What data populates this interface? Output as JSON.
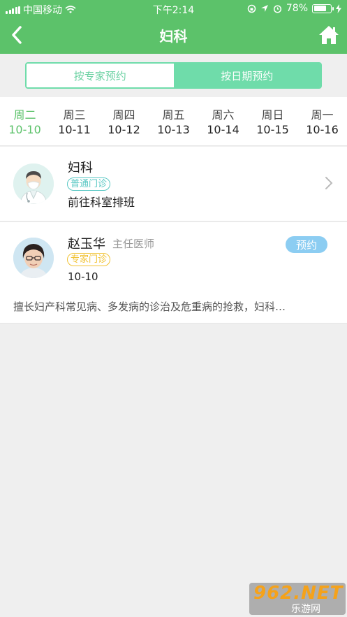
{
  "status_bar": {
    "carrier": "中国移动",
    "time": "下午2:14",
    "battery": "78%",
    "battery_level": 0.78
  },
  "nav": {
    "title": "妇科"
  },
  "segments": [
    {
      "label": "按专家预约",
      "active": false
    },
    {
      "label": "按日期预约",
      "active": true
    }
  ],
  "dates": [
    {
      "weekday": "周二",
      "date": "10-10",
      "active": true
    },
    {
      "weekday": "周三",
      "date": "10-11",
      "active": false
    },
    {
      "weekday": "周四",
      "date": "10-12",
      "active": false
    },
    {
      "weekday": "周五",
      "date": "10-13",
      "active": false
    },
    {
      "weekday": "周六",
      "date": "10-14",
      "active": false
    },
    {
      "weekday": "周日",
      "date": "10-15",
      "active": false
    },
    {
      "weekday": "周一",
      "date": "10-16",
      "active": false
    }
  ],
  "department_card": {
    "name": "妇科",
    "tag": "普通门诊",
    "subtitle": "前往科室排班"
  },
  "doctor_card": {
    "name": "赵玉华",
    "title": "主任医师",
    "tag": "专家门诊",
    "date": "10-10",
    "book_label": "预约",
    "description": "擅长妇产科常见病、多发病的诊治及危重病的抢救，妇科…"
  },
  "watermark": {
    "brand": "962.NET",
    "sub": "乐游网"
  },
  "colors": {
    "header": "#5cc26a",
    "segment_active": "#6fdcaa",
    "book_button": "#8ccdf2",
    "tag_green": "#58c7c3",
    "tag_yellow": "#f1c232"
  }
}
